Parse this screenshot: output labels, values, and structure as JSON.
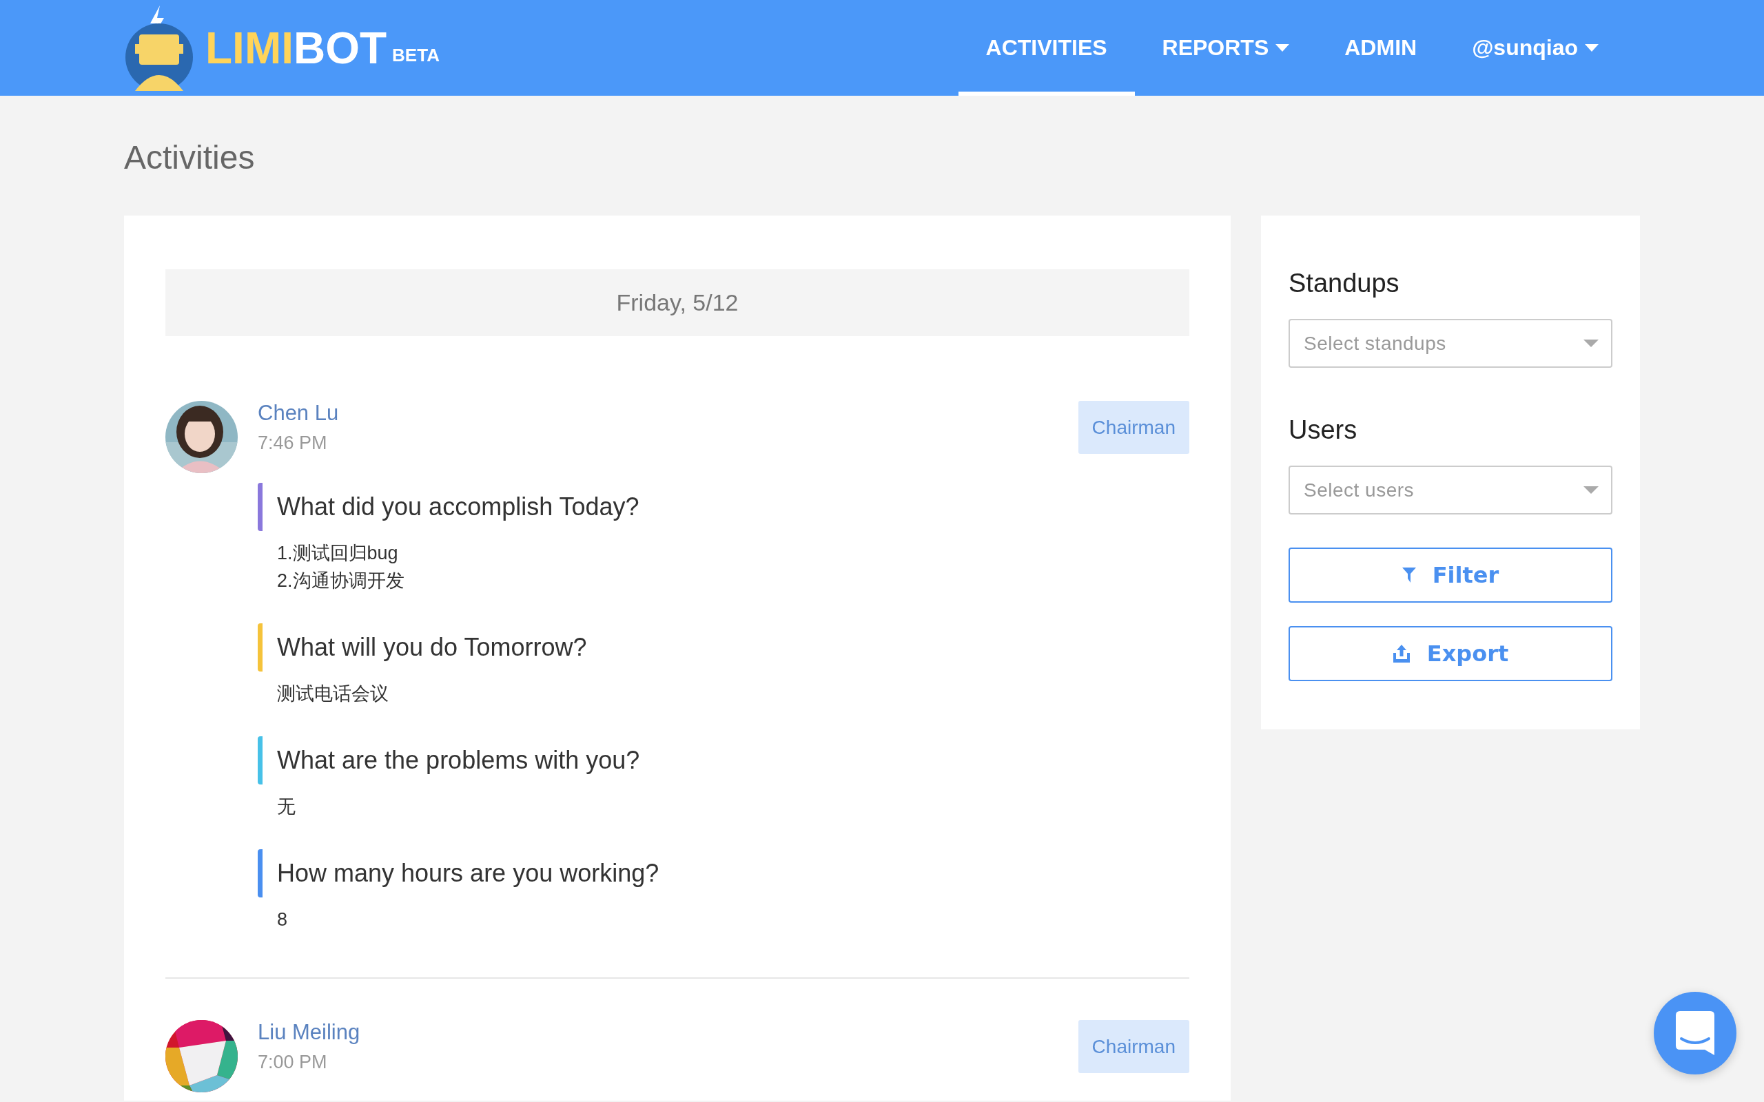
{
  "logo": {
    "name_highlight": "LIMI",
    "name_rest": "BOT",
    "badge": "BETA"
  },
  "nav": [
    {
      "label": "ACTIVITIES",
      "selected": true,
      "dropdown": false
    },
    {
      "label": "REPORTS",
      "selected": false,
      "dropdown": true
    },
    {
      "label": "ADMIN",
      "selected": false,
      "dropdown": false
    },
    {
      "label": "@sunqiao",
      "selected": false,
      "dropdown": true
    }
  ],
  "page_title": "Activities",
  "date_header": "Friday, 5/12",
  "entries": [
    {
      "name": "Chen Lu",
      "time": "7:46 PM",
      "role": "Chairman",
      "questions": [
        {
          "question": "What did you accomplish Today?",
          "color": "#8a78dc",
          "answer_lines": [
            "1.测试回归bug",
            "2.沟通协调开发"
          ]
        },
        {
          "question": "What will you do Tomorrow?",
          "color": "#f5c33b",
          "answer_lines": [
            "测试电话会议"
          ]
        },
        {
          "question": "What are the problems with you?",
          "color": "#47c1e8",
          "answer_lines": [
            "无"
          ]
        },
        {
          "question": "How many hours are you working?",
          "color": "#4a8ff0",
          "answer_lines": [
            "8"
          ]
        }
      ]
    },
    {
      "name": "Liu Meiling",
      "time": "7:00 PM",
      "role": "Chairman"
    }
  ],
  "sidebar": {
    "filters": [
      {
        "title": "Standups",
        "placeholder": "Select standups"
      },
      {
        "title": "Users",
        "placeholder": "Select users"
      }
    ],
    "buttons": [
      {
        "label": "Filter",
        "kind": "filter"
      },
      {
        "label": "Export",
        "kind": "export"
      }
    ]
  }
}
